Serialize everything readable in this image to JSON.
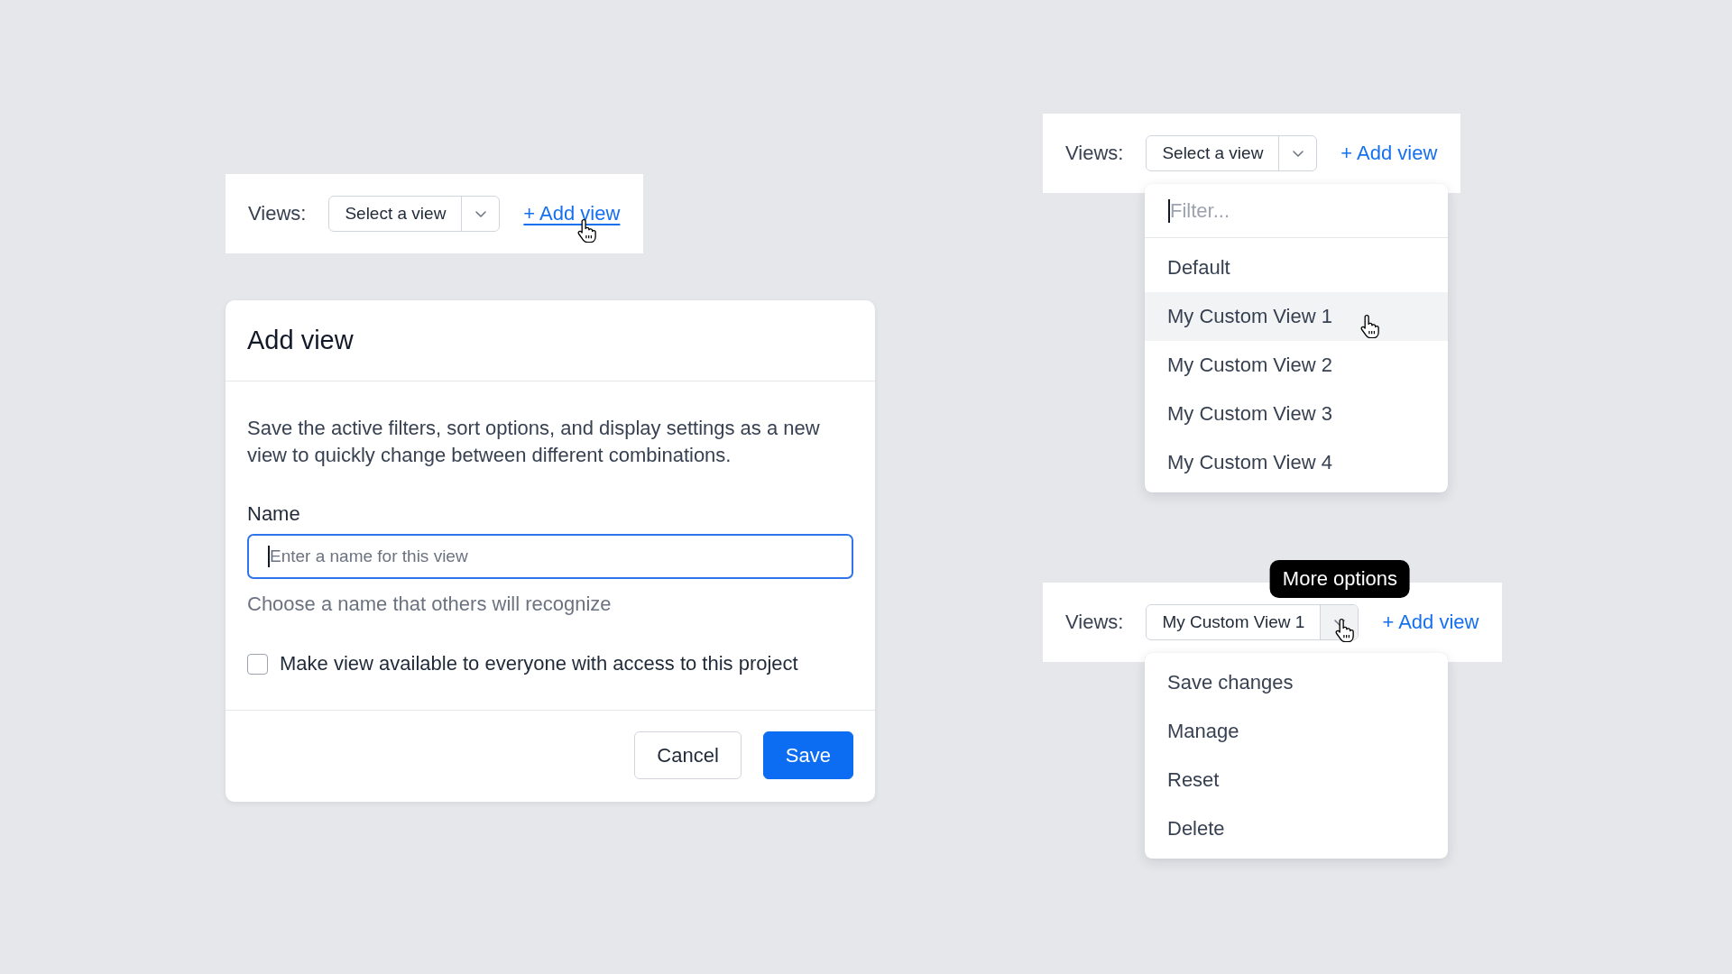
{
  "left": {
    "toolbar": {
      "label": "Views:",
      "select": {
        "value": "Select a view",
        "toggle_hovered": false
      },
      "add_link": {
        "label": "+ Add view",
        "hovered": true
      }
    },
    "dialog": {
      "title": "Add view",
      "description": "Save the active filters, sort options, and display settings as a new view to quickly change between different combinations.",
      "name_field": {
        "label": "Name",
        "placeholder": "Enter a name for this view",
        "focused": true,
        "hint": "Choose a name that others will recognize"
      },
      "share_checkbox": {
        "label": "Make view available to everyone with access to this project",
        "checked": false
      },
      "buttons": [
        {
          "label": "Cancel",
          "kind": "secondary"
        },
        {
          "label": "Save",
          "kind": "primary"
        }
      ]
    }
  },
  "right": {
    "toolbars": [
      {
        "label": "Views:",
        "select": {
          "value": "Select a view",
          "toggle_hovered": false
        },
        "add_link": {
          "label": "+ Add view",
          "hovered": false
        },
        "menu": {
          "filter": {
            "placeholder": "Filter...",
            "focused": true
          },
          "items": [
            {
              "label": "Default",
              "hovered": false
            },
            {
              "label": "My Custom View 1",
              "hovered": true
            },
            {
              "label": "My Custom View 2",
              "hovered": false
            },
            {
              "label": "My Custom View 3",
              "hovered": false
            },
            {
              "label": "My Custom View 4",
              "hovered": false
            }
          ]
        }
      },
      {
        "label": "Views:",
        "select": {
          "value": "My Custom View 1",
          "toggle_hovered": true
        },
        "add_link": {
          "label": "+ Add view",
          "hovered": false
        },
        "tooltip": "More options",
        "menu": {
          "items": [
            {
              "label": "Save changes",
              "hovered": false
            },
            {
              "label": "Manage",
              "hovered": false
            },
            {
              "label": "Reset",
              "hovered": false
            },
            {
              "label": "Delete",
              "hovered": false
            }
          ]
        }
      }
    ]
  }
}
